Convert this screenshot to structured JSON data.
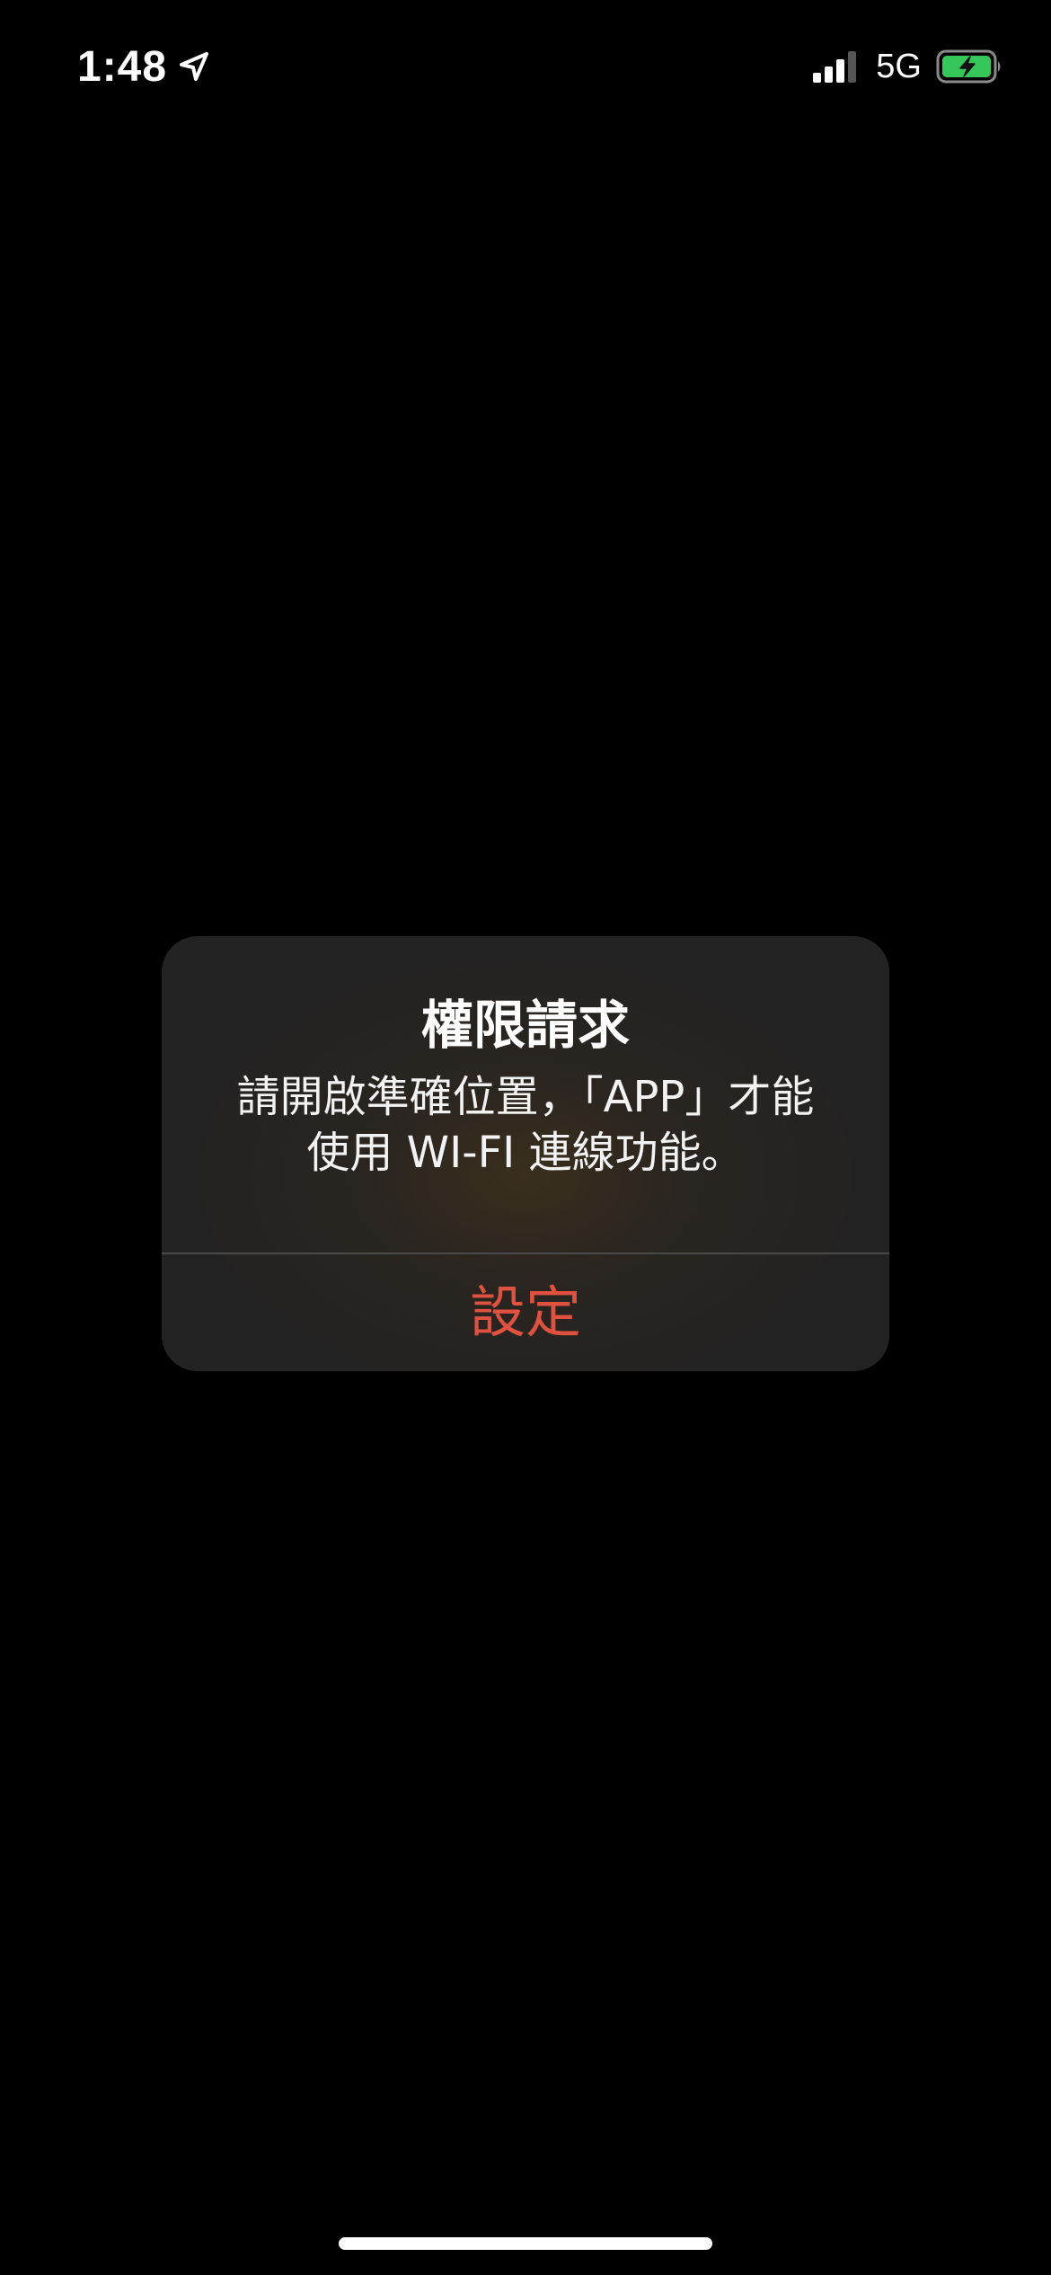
{
  "status_bar": {
    "time": "1:48",
    "location_icon": "location-arrow-icon",
    "signal_icon": "cellular-signal-icon",
    "network": "5G",
    "battery_icon": "battery-charging-icon",
    "battery_color": "#35c759"
  },
  "alert": {
    "title": "權限請求",
    "message": "請開啟準確位置，「APP」才能使用 WI-FI 連線功能。",
    "action_label": "設定",
    "action_color": "#e0523f"
  }
}
